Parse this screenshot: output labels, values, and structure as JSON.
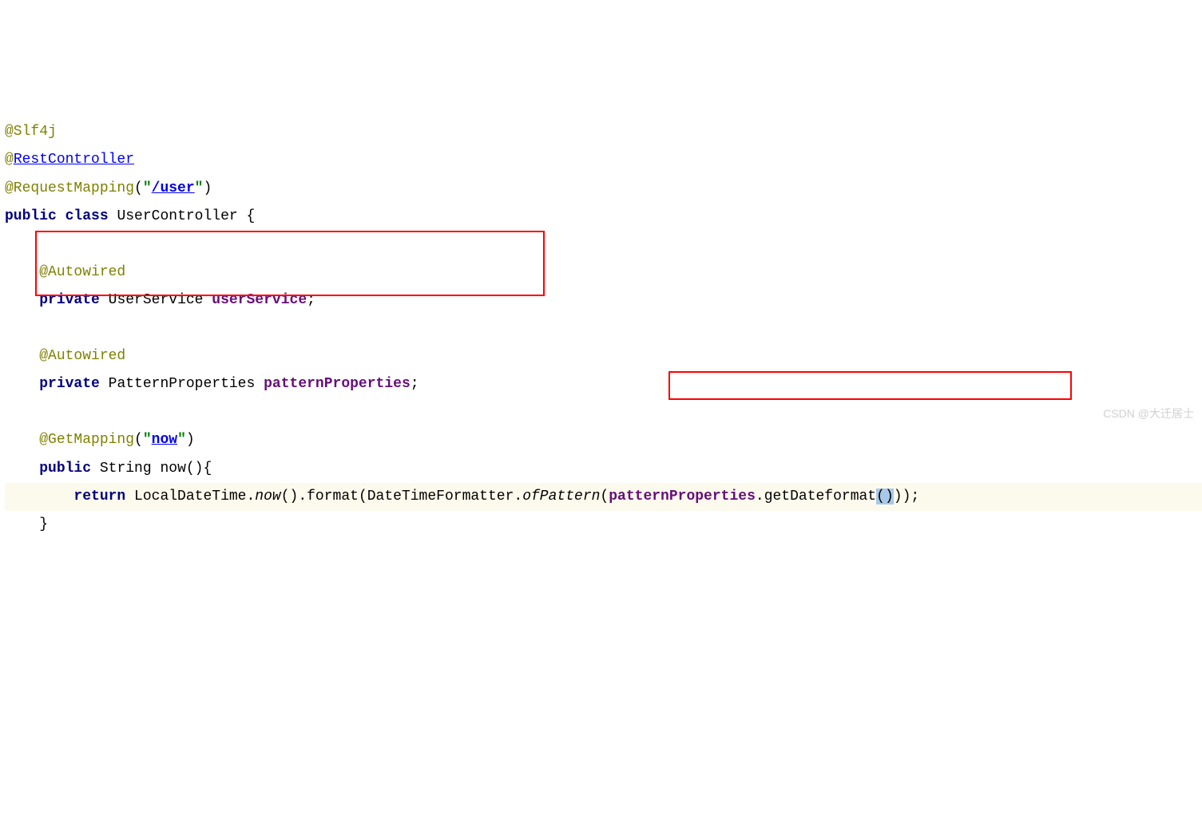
{
  "code": {
    "l1_annotation": "@Slf4j",
    "l2_at": "@",
    "l2_link": "RestController",
    "l3_annotation": "@RequestMapping",
    "l3_paren_open": "(",
    "l3_quote_open": "\"",
    "l3_string_link": "/user",
    "l3_quote_close": "\"",
    "l3_paren_close": ")",
    "l4_public": "public",
    "l4_class": "class",
    "l4_name": "UserController",
    "l4_brace": "{",
    "l6_annotation": "@Autowired",
    "l7_private": "private",
    "l7_type": "UserService",
    "l7_field": "userService",
    "l7_semi": ";",
    "l9_annotation": "@Autowired",
    "l10_private": "private",
    "l10_type": "PatternProperties",
    "l10_field": "patternProperties",
    "l10_semi": ";",
    "l12_annotation": "@GetMapping",
    "l12_paren_open": "(",
    "l12_quote_open": "\"",
    "l12_string_link": "now",
    "l12_quote_close": "\"",
    "l12_paren_close": ")",
    "l13_public": "public",
    "l13_type": "String",
    "l13_method": "now",
    "l13_parens": "()",
    "l13_brace": "{",
    "l14_return": "return",
    "l14_ldt": "LocalDateTime",
    "l14_dot1": ".",
    "l14_now": "now",
    "l14_parens1": "()",
    "l14_dot2": ".",
    "l14_format": "format",
    "l14_paren_open": "(",
    "l14_dtf": "DateTimeFormatter",
    "l14_dot3": ".",
    "l14_ofpattern": "ofPattern",
    "l14_paren_open2": "(",
    "l14_pp": "patternProperties",
    "l14_dot4": ".",
    "l14_getdf": "getDateformat",
    "l14_parens2_open": "(",
    "l14_parens2_close": ")",
    "l14_close1": ")",
    "l14_close2": ")",
    "l14_semi": ";",
    "l15_brace": "}"
  },
  "watermark": "CSDN @大迁居士"
}
